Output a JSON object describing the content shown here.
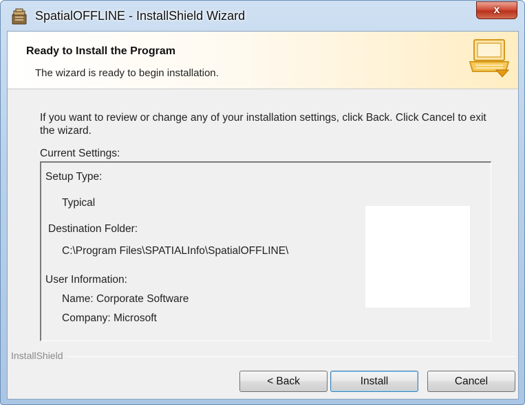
{
  "window": {
    "title": "SpatialOFFLINE - InstallShield Wizard",
    "close_glyph": "x"
  },
  "banner": {
    "title": "Ready to Install the Program",
    "subtitle": "The wizard is ready to begin installation.",
    "icon": "computer-install-icon"
  },
  "body": {
    "description": "If you want to review or change any of your installation settings, click Back. Click Cancel to exit the wizard.",
    "current_settings_label": "Current Settings:"
  },
  "settings": {
    "setup_type_label": "Setup Type:",
    "setup_type_value": "Typical",
    "destination_label": "Destination Folder:",
    "destination_value": "C:\\Program Files\\SPATIALInfo\\SpatialOFFLINE\\",
    "user_info_label": "User Information:",
    "name_line": "Name: Corporate Software",
    "company_line": "Company: Microsoft"
  },
  "footer": {
    "brand": "InstallShield",
    "back_label": "< Back",
    "install_label": "Install",
    "cancel_label": "Cancel"
  },
  "colors": {
    "title_bar": "#b9d1ea",
    "close_button": "#c8412a",
    "banner_gradient_end": "#ffedc2",
    "default_button_border": "#3c7fb1"
  }
}
